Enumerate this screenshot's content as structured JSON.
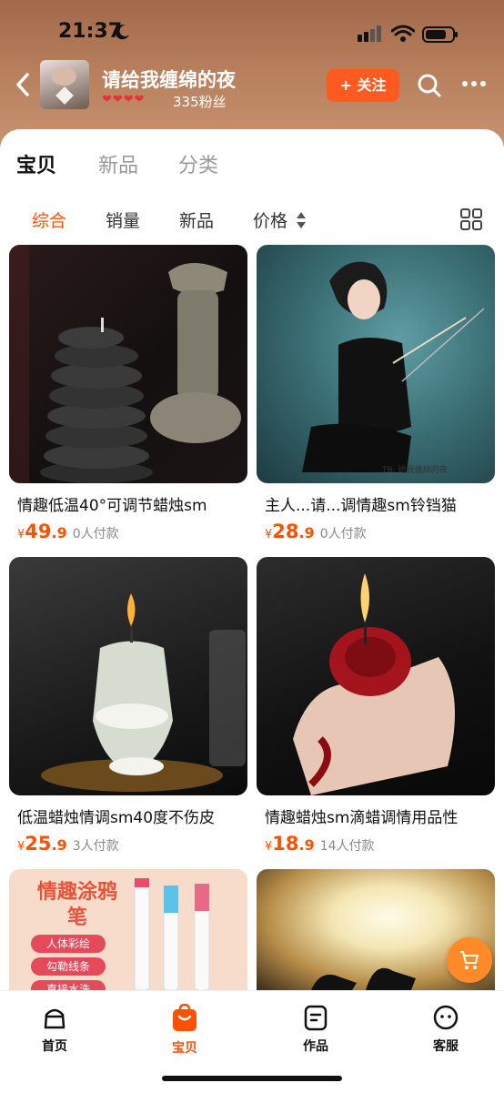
{
  "status_bar": {
    "time": "21:37"
  },
  "shop": {
    "name": "请给我缠绵的夜",
    "hearts": "❤❤❤❤",
    "fans": "335粉丝",
    "follow_label": "+ 关注"
  },
  "tabs": [
    {
      "label": "宝贝",
      "active": true
    },
    {
      "label": "新品",
      "active": false
    },
    {
      "label": "分类",
      "active": false
    }
  ],
  "sort_options": [
    {
      "label": "综合",
      "active": true
    },
    {
      "label": "销量",
      "active": false
    },
    {
      "label": "新品",
      "active": false
    },
    {
      "label": "价格",
      "active": false
    }
  ],
  "products": [
    {
      "title": "情趣低温40°可调节蜡烛sm",
      "currency": "¥",
      "price_int": "49",
      "price_dec": ".9",
      "sold": "0人付款"
    },
    {
      "title": "主人...请...调情趣sm铃铛猫",
      "currency": "¥",
      "price_int": "28",
      "price_dec": ".9",
      "sold": "0人付款",
      "watermark": "TB: 给我缠绵的夜"
    },
    {
      "title": "低温蜡烛情调sm40度不伤皮",
      "currency": "¥",
      "price_int": "25",
      "price_dec": ".9",
      "sold": "3人付款"
    },
    {
      "title": "情趣蜡烛sm滴蜡调情用品性",
      "currency": "¥",
      "price_int": "18",
      "price_dec": ".9",
      "sold": "14人付款"
    },
    {
      "promo_title": "情趣涂鸦笔",
      "chips": [
        "人体彩绘",
        "勾勒线条",
        "直接水洗"
      ]
    },
    {}
  ],
  "bottom_nav": [
    {
      "label": "首页",
      "icon": "home-icon",
      "active": false
    },
    {
      "label": "宝贝",
      "icon": "bag-icon",
      "active": true
    },
    {
      "label": "作品",
      "icon": "works-icon",
      "active": false
    },
    {
      "label": "客服",
      "icon": "service-icon",
      "active": false
    }
  ],
  "colors": {
    "accent": "#ff5000",
    "follow_bg": "#ff5a1f",
    "cart_fab": "#ff8a2a"
  }
}
